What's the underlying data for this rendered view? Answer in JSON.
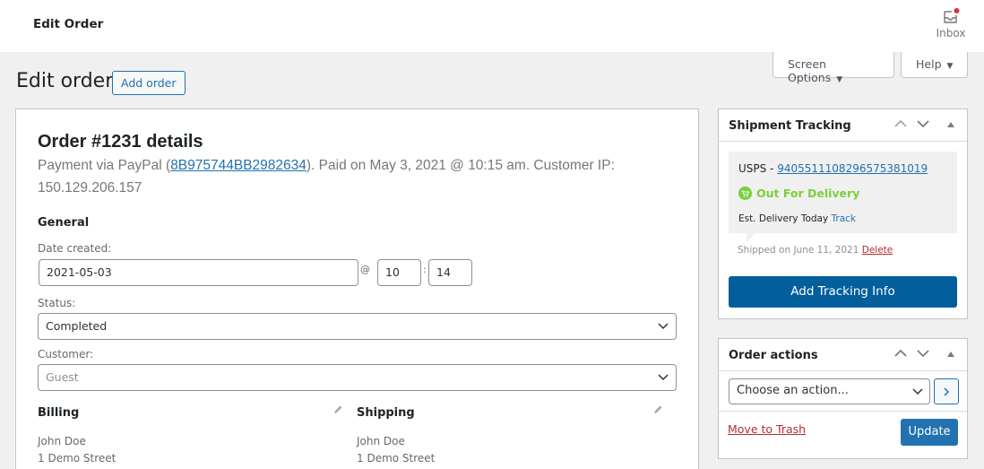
{
  "topbar": {
    "title": "Edit Order",
    "inbox_label": "Inbox",
    "inbox_has_notification": true
  },
  "screen_meta": {
    "screen_options_label": "Screen Options",
    "help_label": "Help"
  },
  "page": {
    "title": "Edit order",
    "add_order_label": "Add order"
  },
  "order": {
    "heading": "Order #1231 details",
    "payment_prefix": "Payment via PayPal (",
    "transaction_id": "8B975744BB2982634",
    "payment_suffix": "). Paid on May 3, 2021 @ 10:15 am. Customer IP: 150.129.206.157",
    "general": {
      "heading": "General",
      "date_created_label": "Date created:",
      "date_value": "2021-05-03",
      "at_symbol": "@",
      "hour": "10",
      "colon": ":",
      "minute": "14",
      "status_label": "Status:",
      "status_value": "Completed",
      "customer_label": "Customer:",
      "customer_value": "Guest"
    },
    "billing": {
      "heading": "Billing",
      "lines": [
        "John Doe",
        "1 Demo Street"
      ]
    },
    "shipping": {
      "heading": "Shipping",
      "lines": [
        "John Doe",
        "1 Demo Street"
      ]
    }
  },
  "shipment_tracking": {
    "title": "Shipment Tracking",
    "carrier": "USPS - ",
    "tracking_number": "9405511108296575381019",
    "status": "Out For Delivery",
    "status_color": "#7ad03a",
    "est_delivery": "Est. Delivery Today ",
    "track_link": "Track",
    "shipped_on": "Shipped on June 11, 2021 ",
    "delete_link": "Delete",
    "add_button": "Add Tracking Info"
  },
  "order_actions": {
    "title": "Order actions",
    "select_value": "Choose an action...",
    "move_to_trash": "Move to Trash",
    "update_label": "Update"
  }
}
